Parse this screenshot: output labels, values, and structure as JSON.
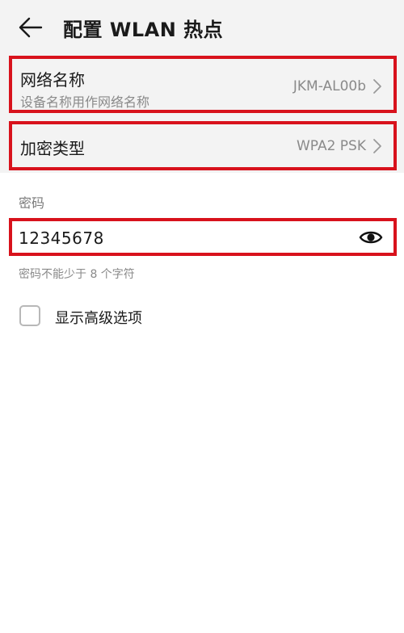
{
  "header": {
    "title": "配置 WLAN 热点",
    "back_icon": "arrow-left-icon"
  },
  "network_name": {
    "title": "网络名称",
    "subtitle": "设备名称用作网络名称",
    "value": "JKM-AL00b",
    "chevron_icon": "chevron-right-icon"
  },
  "encryption": {
    "title": "加密类型",
    "value": "WPA2 PSK",
    "chevron_icon": "chevron-right-icon"
  },
  "password": {
    "label": "密码",
    "value": "12345678",
    "toggle_icon": "eye-icon",
    "hint": "密码不能少于 8 个字符"
  },
  "advanced": {
    "label": "显示高级选项",
    "checked": false
  },
  "colors": {
    "highlight_border": "#d8121c",
    "section_background": "#f3f3f3",
    "secondary_text": "#8a8a8a"
  }
}
